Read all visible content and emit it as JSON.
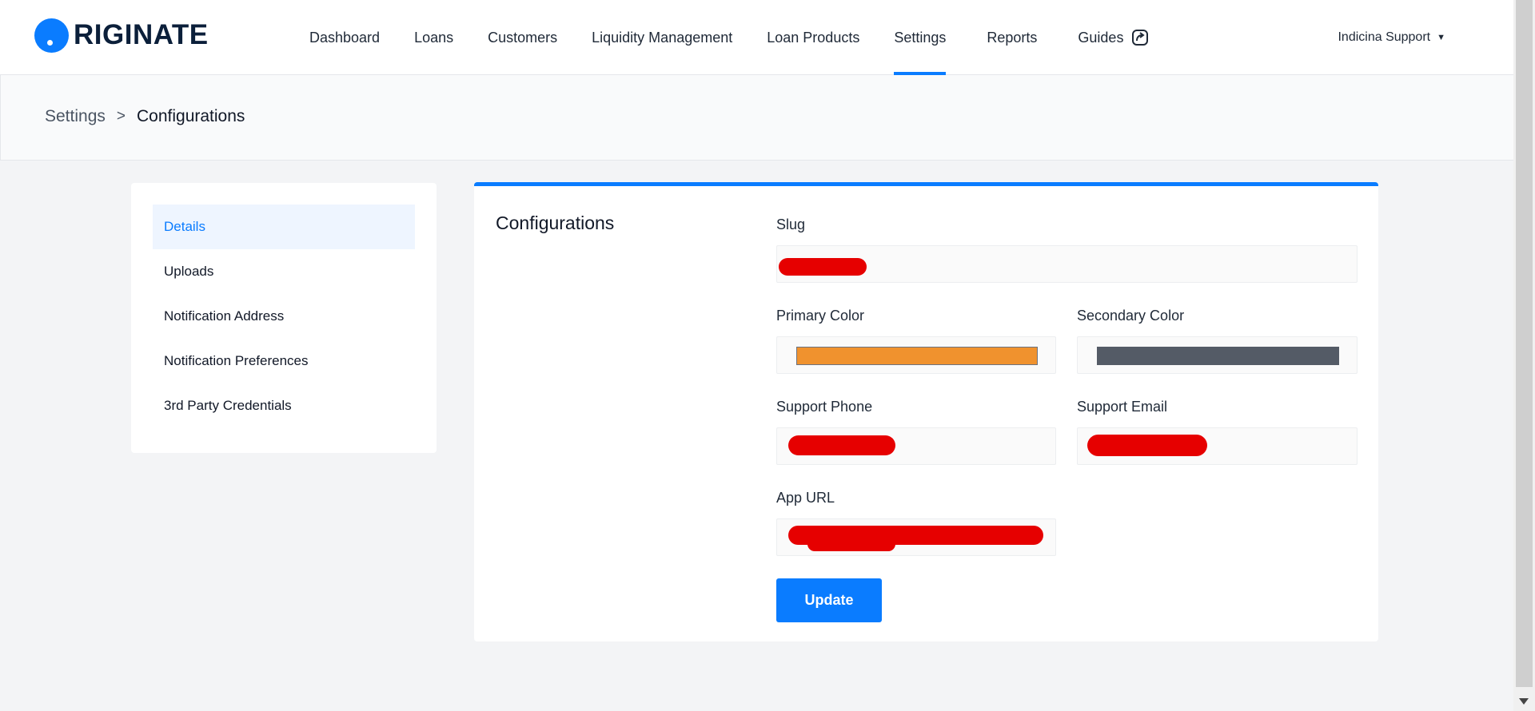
{
  "brand": {
    "logo_text": "RIGINATE",
    "accent_color": "#0a7cff"
  },
  "nav": {
    "items": [
      {
        "label": "Dashboard"
      },
      {
        "label": "Loans"
      },
      {
        "label": "Customers"
      },
      {
        "label": "Liquidity Management"
      },
      {
        "label": "Loan Products"
      },
      {
        "label": "Settings",
        "active": true
      },
      {
        "label": "Reports"
      },
      {
        "label": "Guides",
        "icon": "external-link-icon"
      }
    ],
    "user_label": "Indicina Support",
    "user_caret_icon": "caret-down-icon"
  },
  "breadcrumb": {
    "items": [
      "Settings",
      "Configurations"
    ],
    "separator": ">"
  },
  "side_menu": {
    "items": [
      {
        "label": "Details",
        "active": true
      },
      {
        "label": "Uploads"
      },
      {
        "label": "Notification Address"
      },
      {
        "label": "Notification Preferences"
      },
      {
        "label": "3rd Party Credentials"
      }
    ]
  },
  "form": {
    "title": "Configurations",
    "fields": {
      "slug": {
        "label": "Slug",
        "value": ""
      },
      "primary_color": {
        "label": "Primary Color",
        "value": "#f0922e"
      },
      "secondary_color": {
        "label": "Secondary Color",
        "value": "#545b66"
      },
      "support_phone": {
        "label": "Support Phone",
        "value": ""
      },
      "support_email": {
        "label": "Support Email",
        "value": ""
      },
      "app_url": {
        "label": "App URL",
        "value": ""
      }
    },
    "submit_label": "Update"
  }
}
